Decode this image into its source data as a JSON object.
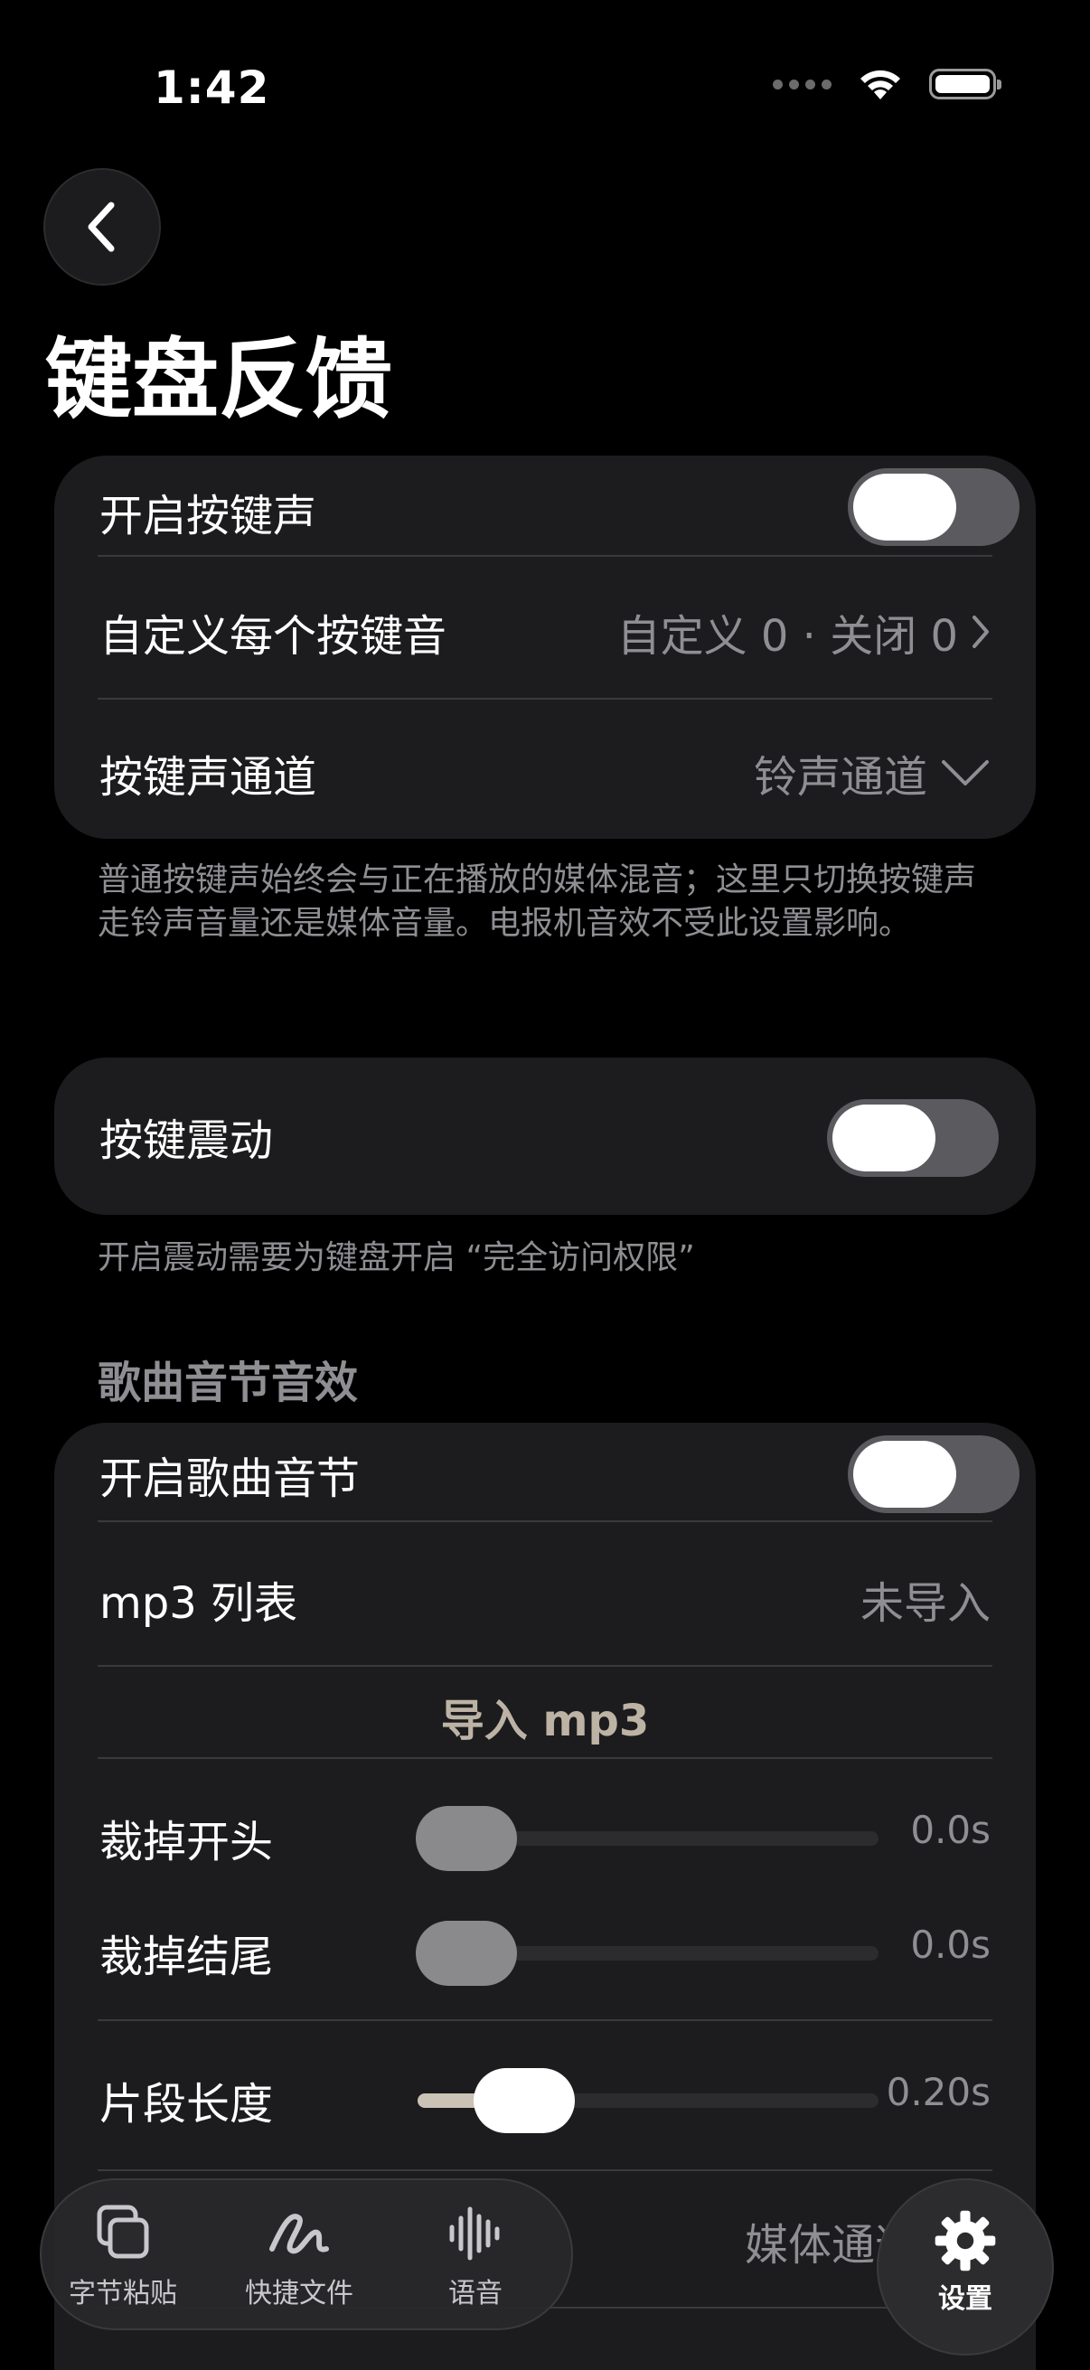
{
  "status_bar": {
    "time": "1:42"
  },
  "header": {
    "title": "键盘反馈"
  },
  "key_sound_card": {
    "enable_label": "开启按键声",
    "enable_on": false,
    "custom_label": "自定义每个按键音",
    "custom_value": "自定义 0 · 关闭 0",
    "channel_label": "按键声通道",
    "channel_value": "铃声通道"
  },
  "key_sound_note": "普通按键声始终会与正在播放的媒体混音；这里只切换按键声走铃声音量还是媒体音量。电报机音效不受此设置影响。",
  "vibration_card": {
    "label": "按键震动",
    "enabled": false
  },
  "vibration_note": "开启震动需要为键盘开启 “完全访问权限”",
  "song_section": {
    "header": "歌曲音节音效",
    "enable_label": "开启歌曲音节",
    "enable_on": false,
    "mp3_label": "mp3 列表",
    "mp3_value": "未导入",
    "import_label": "导入 mp3",
    "trim_start_label": "裁掉开头",
    "trim_start_value": "0.0s",
    "trim_start_fraction": 0.0,
    "trim_end_label": "裁掉结尾",
    "trim_end_value": "0.0s",
    "trim_end_fraction": 0.0,
    "segment_label": "片段长度",
    "segment_value": "0.20s",
    "segment_fraction": 0.2,
    "channel_value": "媒体通道"
  },
  "tabbar": {
    "tabs": [
      {
        "label": "字节粘贴",
        "icon": "copy-icon"
      },
      {
        "label": "快捷文件",
        "icon": "scribble-icon"
      },
      {
        "label": "语音",
        "icon": "waveform-icon"
      }
    ],
    "settings": {
      "label": "设置",
      "icon": "gear-icon"
    }
  }
}
